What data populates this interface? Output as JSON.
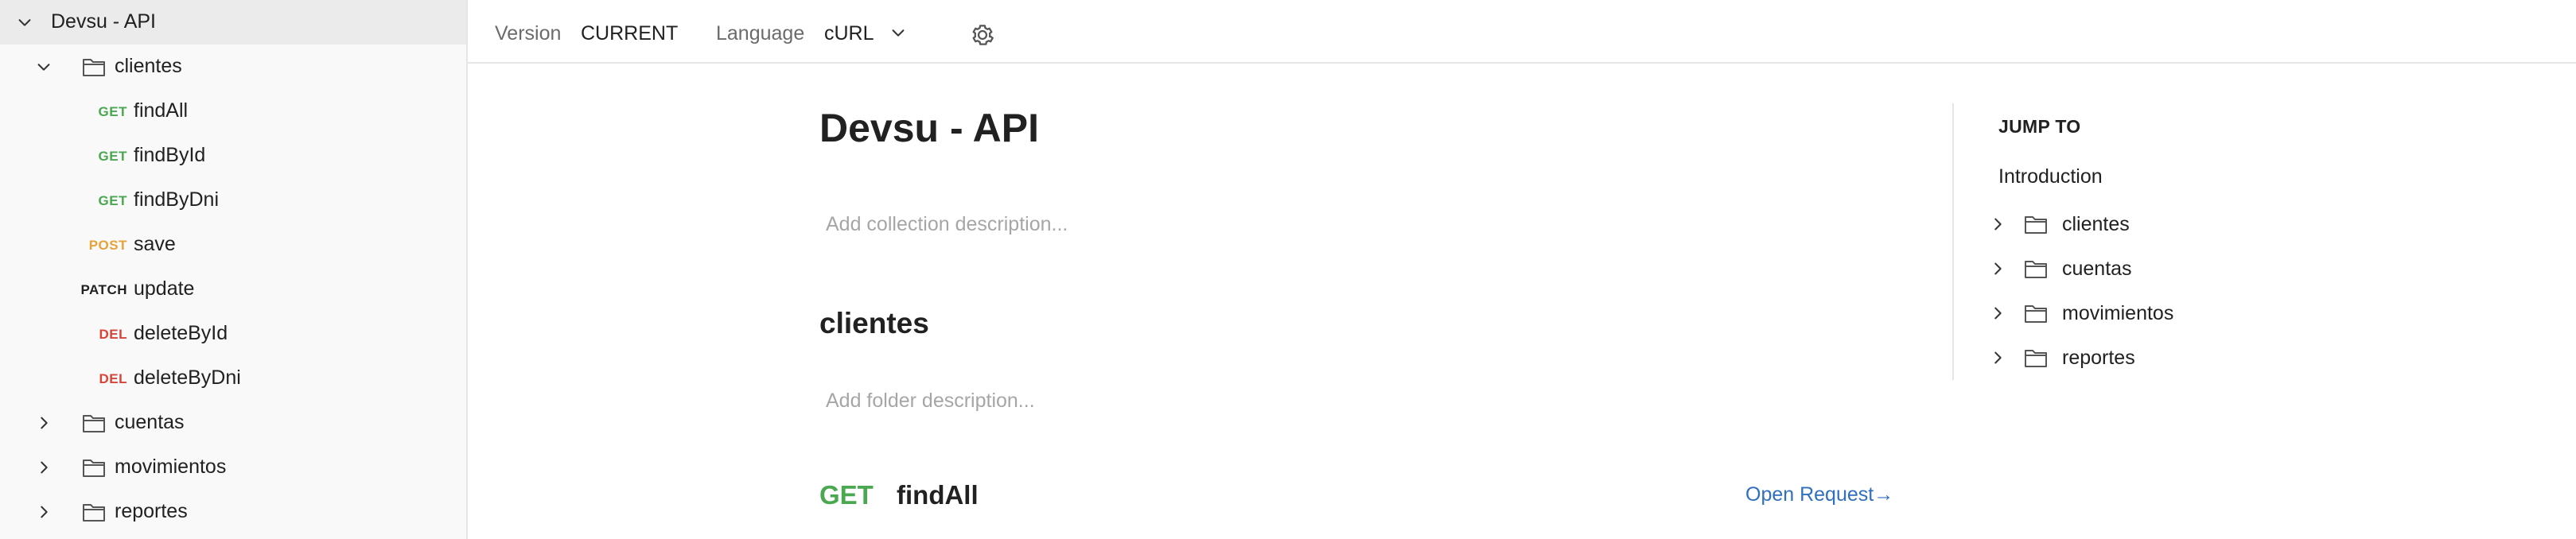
{
  "colors": {
    "get": "#4aa851",
    "post": "#e7a23a",
    "patch": "#212121",
    "del": "#d7453a",
    "link": "#2f6fbf",
    "placeholder": "#a6a6a6"
  },
  "sidebar": {
    "collection": "Devsu - API",
    "folders": {
      "clientes": "clientes",
      "cuentas": "cuentas",
      "movimientos": "movimientos",
      "reportes": "reportes"
    },
    "requests": [
      {
        "method": "GET",
        "name": "findAll"
      },
      {
        "method": "GET",
        "name": "findById"
      },
      {
        "method": "GET",
        "name": "findByDni"
      },
      {
        "method": "POST",
        "name": "save"
      },
      {
        "method": "PATCH",
        "name": "update"
      },
      {
        "method": "DEL",
        "name": "deleteById"
      },
      {
        "method": "DEL",
        "name": "deleteByDni"
      }
    ]
  },
  "topbar": {
    "version_label": "Version",
    "version_value": "CURRENT",
    "language_label": "Language",
    "language_value": "cURL",
    "settings_icon": "gear-icon"
  },
  "main": {
    "title": "Devsu - API",
    "collection_desc_placeholder": "Add collection description...",
    "folder_title": "clientes",
    "folder_desc_placeholder": "Add folder description...",
    "request": {
      "method": "GET",
      "name": "findAll",
      "open_label": "Open Request→"
    }
  },
  "jump_to": {
    "heading": "JUMP TO",
    "intro": "Introduction",
    "folders": [
      "clientes",
      "cuentas",
      "movimientos",
      "reportes"
    ]
  }
}
